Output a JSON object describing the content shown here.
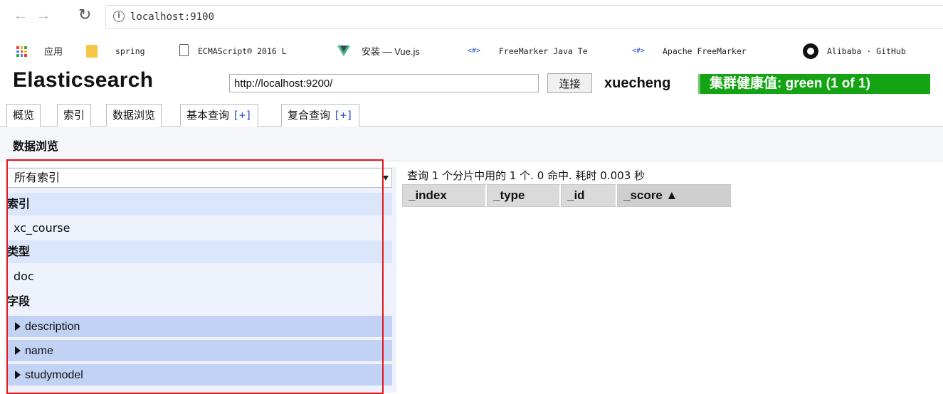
{
  "browser": {
    "url": "localhost:9100",
    "bookmarks": [
      {
        "label": "应用"
      },
      {
        "label": "spring"
      },
      {
        "label": "ECMAScript® 2016 L"
      },
      {
        "label": "安装 — Vue.js"
      },
      {
        "label": "FreeMarker Java Te"
      },
      {
        "label": "Apache FreeMarker"
      },
      {
        "label": "Alibaba · GitHub"
      }
    ],
    "hash_icon_text": "<#>"
  },
  "header": {
    "title": "Elasticsearch",
    "server_url": "http://localhost:9200/",
    "connect_label": "连接",
    "cluster_name": "xuecheng",
    "health_text": "集群健康值: green (1 of 1)",
    "health_color": "#13a313"
  },
  "tabs": [
    {
      "label": "概览",
      "plus": ""
    },
    {
      "label": "索引",
      "plus": ""
    },
    {
      "label": "数据浏览",
      "plus": ""
    },
    {
      "label": "基本查询",
      "plus": "[+]"
    },
    {
      "label": "复合查询",
      "plus": "[+]"
    }
  ],
  "section_title": "数据浏览",
  "filter": {
    "selected_index": "所有索引",
    "index_label": "索引",
    "indices": [
      "xc_course"
    ],
    "type_label": "类型",
    "types": [
      "doc"
    ],
    "field_label": "字段",
    "fields": [
      "description",
      "name",
      "studymodel"
    ]
  },
  "results": {
    "summary": "查询 1 个分片中用的 1 个. 0 命中. 耗时 0.003 秒",
    "columns": [
      "_index",
      "_type",
      "_id",
      "_score ▲"
    ]
  },
  "colors": {
    "highlight_border": "#e4171e",
    "field_row_bg": "#c2d2f5"
  }
}
